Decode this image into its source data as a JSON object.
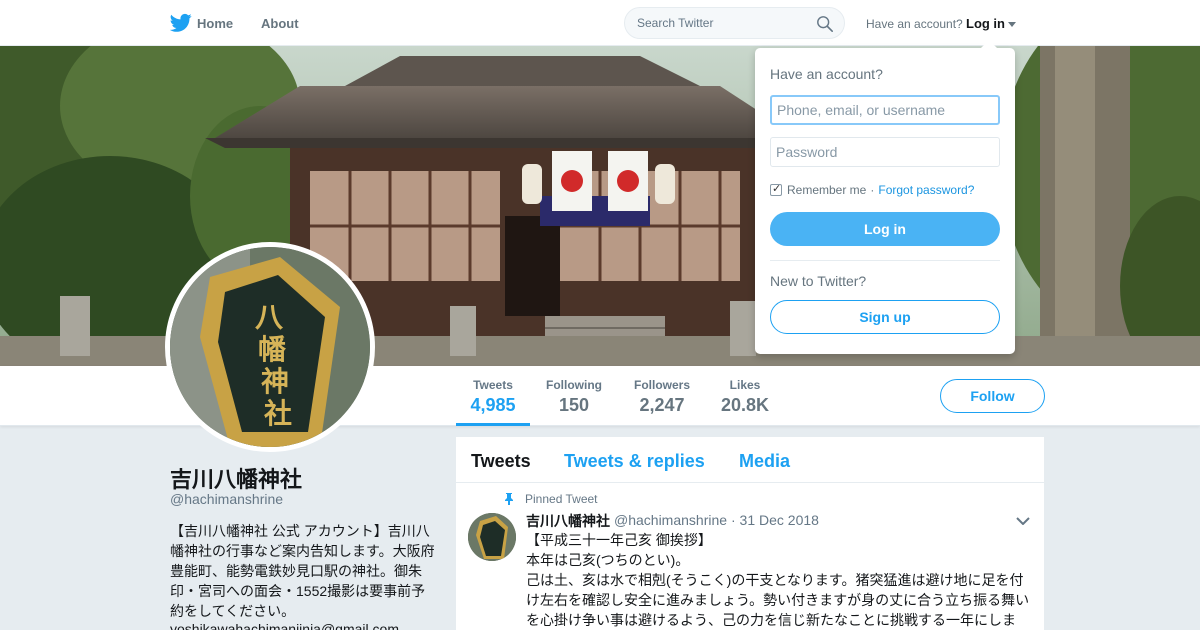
{
  "nav": {
    "home": "Home",
    "about": "About",
    "search_placeholder": "Search Twitter",
    "have_account": "Have an account?",
    "login": "Log in"
  },
  "login_dropdown": {
    "title": "Have an account?",
    "username_placeholder": "Phone, email, or username",
    "password_placeholder": "Password",
    "remember": "Remember me",
    "separator": "·",
    "forgot": "Forgot password?",
    "login_button": "Log in",
    "new_label": "New to Twitter?",
    "signup_button": "Sign up"
  },
  "stats": [
    {
      "label": "Tweets",
      "value": "4,985"
    },
    {
      "label": "Following",
      "value": "150"
    },
    {
      "label": "Followers",
      "value": "2,247"
    },
    {
      "label": "Likes",
      "value": "20.8K"
    }
  ],
  "follow_button": "Follow",
  "profile": {
    "name": "吉川八幡神社",
    "handle": "@hachimanshrine",
    "bio": "【吉川八幡神社 公式 アカウント】吉川八幡神社の行事など案内告知します。大阪府豊能町、能勢電鉄妙見口駅の神社。御朱印・宮司への面会・1552撮影は要事前予約をしてください。",
    "email": "yoshikawahachimanjinja@gmail.com"
  },
  "timeline": {
    "tabs": [
      "Tweets",
      "Tweets & replies",
      "Media"
    ],
    "pinned_label": "Pinned Tweet",
    "tweet": {
      "name": "吉川八幡神社",
      "handle": "@hachimanshrine",
      "date": "· 31 Dec 2018",
      "lines": [
        "【平成三十一年己亥 御挨拶】",
        "本年は己亥(つちのとい)。",
        "己は土、亥は水で相剋(そうこく)の干支となります。猪突猛進は避け地に足を付け左右を確認し安全に進みましょう。勢い付きますが身の丈に合う立ち振る舞いを心掛け争い事は避けるよう、己の力を信じ新たなことに挑戦する一年にしま"
      ]
    }
  },
  "colors": {
    "accent": "#1da1f2",
    "text_primary": "#14171a",
    "text_secondary": "#657786"
  }
}
